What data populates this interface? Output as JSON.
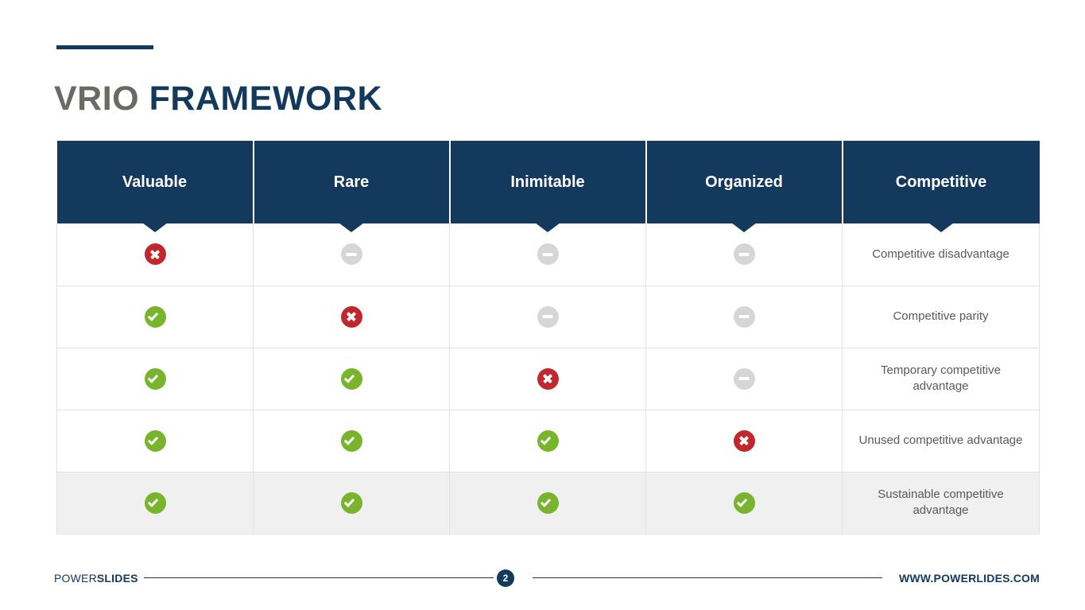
{
  "slide": {
    "title_part1": "VRIO ",
    "title_part2": "FRAMEWORK",
    "accent_color": "#13395c",
    "title_gray_color": "#6b6b66"
  },
  "table": {
    "headers": [
      {
        "label": "Valuable"
      },
      {
        "label": "Rare"
      },
      {
        "label": "Inimitable"
      },
      {
        "label": "Organized"
      },
      {
        "label": "Competitive"
      }
    ],
    "rows": [
      {
        "cells": [
          "no",
          "na",
          "na",
          "na"
        ],
        "outcome": "Competitive disadvantage",
        "highlight": false
      },
      {
        "cells": [
          "yes",
          "no",
          "na",
          "na"
        ],
        "outcome": "Competitive parity",
        "highlight": false
      },
      {
        "cells": [
          "yes",
          "yes",
          "no",
          "na"
        ],
        "outcome": "Temporary competitive advantage",
        "highlight": false
      },
      {
        "cells": [
          "yes",
          "yes",
          "yes",
          "no"
        ],
        "outcome": "Unused competitive advantage",
        "highlight": false
      },
      {
        "cells": [
          "yes",
          "yes",
          "yes",
          "yes"
        ],
        "outcome": "Sustainable competitive advantage",
        "highlight": true
      }
    ],
    "icon_names": {
      "yes": "check-circle-icon",
      "no": "x-circle-icon",
      "na": "dash-circle-icon"
    },
    "colors": {
      "header_bg": "#13395c",
      "yes": "#79b52c",
      "no": "#c1272d",
      "na": "#d6d6d6",
      "row_highlight_bg": "#f0f0f0",
      "grid_line": "#e2e2e2"
    }
  },
  "footer": {
    "brand_light": "POWER",
    "brand_bold": "SLIDES",
    "page_number": "2",
    "url": "WWW.POWERLIDES.COM"
  }
}
